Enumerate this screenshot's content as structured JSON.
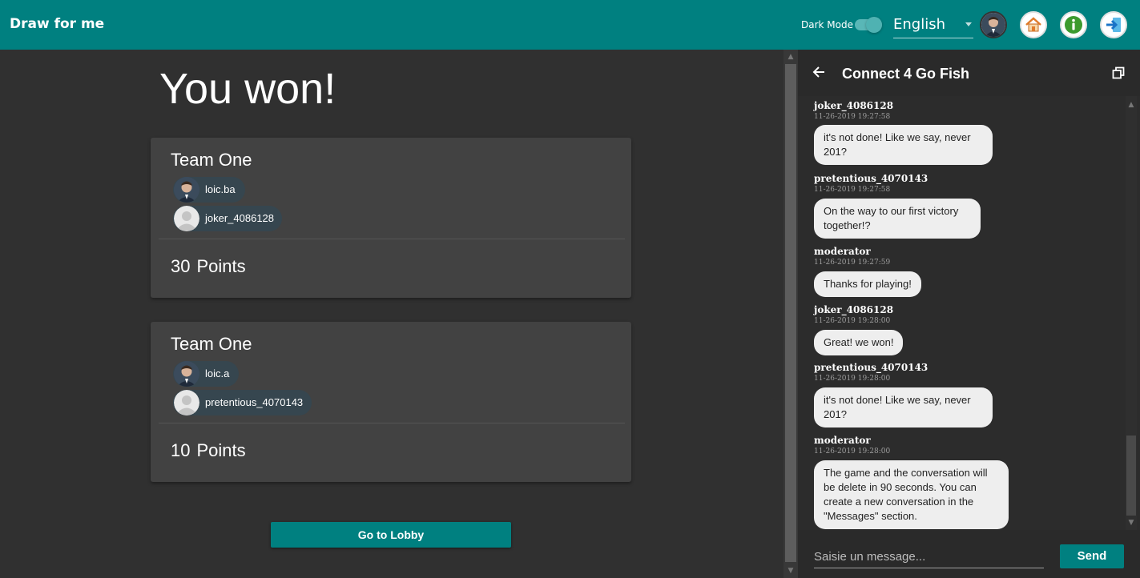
{
  "app": {
    "title": "Draw for me"
  },
  "topbar": {
    "dark_mode_label": "Dark Mode",
    "dark_mode_on": true,
    "language": "English",
    "icons": [
      "user-avatar",
      "home-icon",
      "info-icon",
      "logout-icon"
    ]
  },
  "main": {
    "heading": "You won!",
    "teams": [
      {
        "name": "Team One",
        "players": [
          {
            "name": "loic.ba",
            "avatar": "photo"
          },
          {
            "name": "joker_4086128",
            "avatar": "default"
          }
        ],
        "points": "30",
        "points_label": "Points"
      },
      {
        "name": "Team One",
        "players": [
          {
            "name": "loic.a",
            "avatar": "photo"
          },
          {
            "name": "pretentious_4070143",
            "avatar": "default"
          }
        ],
        "points": "10",
        "points_label": "Points"
      }
    ],
    "lobby_button": "Go to Lobby"
  },
  "chat": {
    "title": "Connect 4 Go Fish",
    "messages": [
      {
        "author": "joker_4086128",
        "time": "11-26-2019 19:27:58",
        "text": " it's not done! Like we say, never 201?"
      },
      {
        "author": "pretentious_4070143",
        "time": "11-26-2019 19:27:58",
        "text": "On the way to our first victory together!?"
      },
      {
        "author": "moderator",
        "time": "11-26-2019 19:27:59",
        "text": "Thanks for playing!"
      },
      {
        "author": "joker_4086128",
        "time": "11-26-2019 19:28:00",
        "text": "Great!  we won!"
      },
      {
        "author": "pretentious_4070143",
        "time": "11-26-2019 19:28:00",
        "text": " it's not done! Like we say, never 201?"
      },
      {
        "author": "moderator",
        "time": "11-26-2019 19:28:00",
        "text": "The game and the conversation will be delete in 90 seconds. You can create a new conversation in the \"Messages\" section."
      }
    ],
    "input_placeholder": "Saisie un message...",
    "send_label": "Send"
  },
  "colors": {
    "accent": "#008080",
    "background": "#303030",
    "card": "#424242",
    "chip": "#36464f",
    "bubble": "#eeeeee"
  }
}
